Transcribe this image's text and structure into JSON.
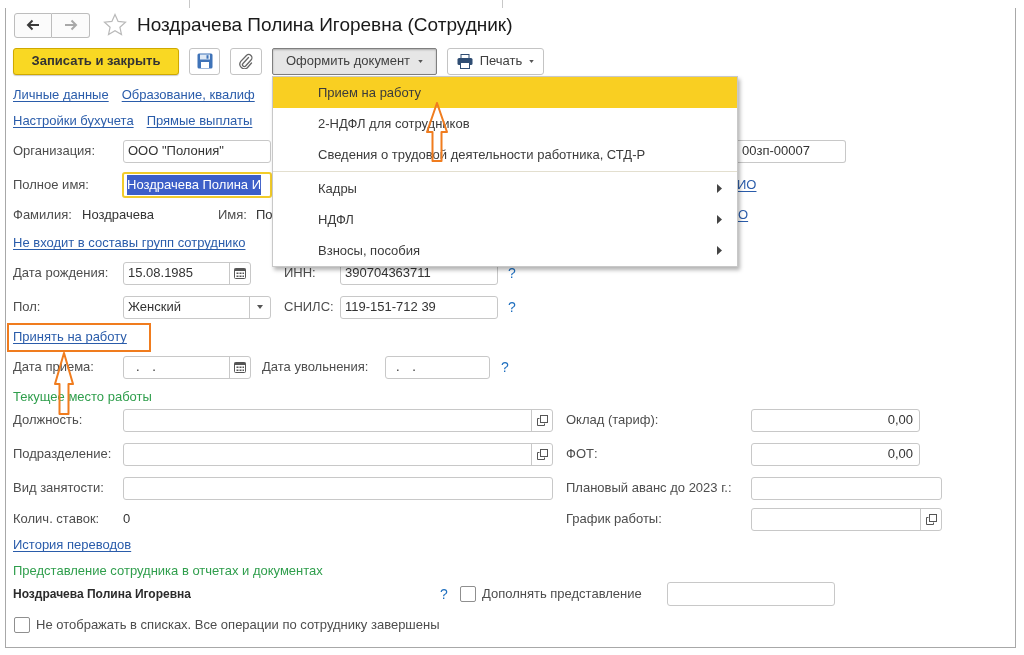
{
  "window": {
    "title": "Ноздрачева Полина Игоревна (Сотрудник)",
    "favorite": false
  },
  "navigation": [
    {
      "kind": "back",
      "disabled": false
    },
    {
      "kind": "forward",
      "disabled": true
    }
  ],
  "toolbar": {
    "primary_button": "Записать и закрыть",
    "document_button": {
      "label": "Оформить документ",
      "pressed": true
    },
    "print_button": "Печать"
  },
  "document_menu": {
    "groups": [
      {
        "items": [
          {
            "label": "Прием на работу",
            "selected": true,
            "submenu": false
          },
          {
            "label": "2-НДФЛ для сотрудников",
            "selected": false,
            "submenu": false
          },
          {
            "label": "Сведения о трудовой деятельности работника, СТД-Р",
            "selected": false,
            "submenu": false
          }
        ]
      },
      {
        "items": [
          {
            "label": "Кадры",
            "selected": false,
            "submenu": true
          },
          {
            "label": "НДФЛ",
            "selected": false,
            "submenu": true
          },
          {
            "label": "Взносы, пособия",
            "selected": false,
            "submenu": true
          }
        ]
      }
    ]
  },
  "section_links": [
    [
      "Личные данные",
      "Образование, квалиф"
    ],
    [
      "Настройки бухучета",
      "Прямые выплаты"
    ]
  ],
  "organization": {
    "label": "Организация:",
    "value": "ООО \"Полония\""
  },
  "personnel_number": "00зп-00007",
  "full_name": {
    "label": "Полное имя:",
    "value": "Ноздрачева Полина И",
    "focused": true,
    "text_selected": true,
    "link": "ИО"
  },
  "name_parts": {
    "surname_label": "Фамилия:",
    "surname": "Ноздрачева",
    "name_label": "Имя:",
    "name": "По",
    "link": "О"
  },
  "groups_link": "Не входит в составы групп сотруднико",
  "birth_date": {
    "label": "Дата рождения:",
    "value": "15.08.1985"
  },
  "inn": {
    "label": "ИНН:",
    "value": "390704363711",
    "help": "?"
  },
  "gender": {
    "label": "Пол:",
    "value": "Женский"
  },
  "snils": {
    "label": "СНИЛС:",
    "value": "119-151-712 39",
    "help": "?"
  },
  "hire_link": "Принять на работу",
  "hire_date": {
    "label": "Дата приема:",
    "value": ". ."
  },
  "dismissal_date": {
    "label": "Дата увольнения:",
    "value": ". .",
    "help": "?"
  },
  "current_job": {
    "title": "Текущее место работы",
    "rows": [
      {
        "left": {
          "kind": "choice",
          "label": "Должность:"
        },
        "right": {
          "kind": "number",
          "label": "Оклад (тариф):",
          "value": "0,00"
        }
      },
      {
        "left": {
          "kind": "choice",
          "label": "Подразделение:"
        },
        "right": {
          "kind": "number",
          "label": "ФОТ:",
          "value": "0,00"
        }
      },
      {
        "left": {
          "kind": "input",
          "label": "Вид занятости:"
        },
        "right": {
          "kind": "input",
          "label": "Плановый аванс до 2023 г.:"
        }
      },
      {
        "left": {
          "kind": "text",
          "label": "Колич. ставок:",
          "value": "0"
        },
        "right": {
          "kind": "choice",
          "label": "График работы:"
        }
      }
    ]
  },
  "history_link": "История переводов",
  "representation": {
    "title": "Представление сотрудника в отчетах и документах",
    "value": "Ноздрачева Полина Игоревна",
    "help": "?",
    "supplement": {
      "label": "Дополнять представление",
      "checked": false
    }
  },
  "hide_in_lists": {
    "label": "Не отображать в списках. Все операции по сотруднику завершены",
    "checked": false
  }
}
